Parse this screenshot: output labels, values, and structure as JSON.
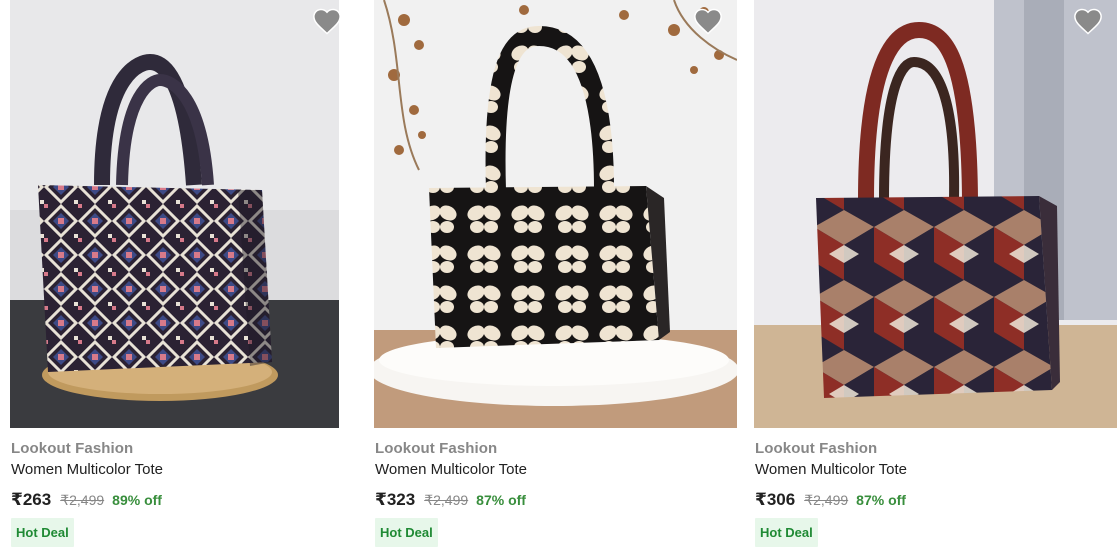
{
  "products": [
    {
      "brand": "Lookout Fashion",
      "title": "Women Multicolor Tote",
      "price": "₹263",
      "mrp": "₹2,499",
      "discount": "89% off",
      "badge": "Hot Deal",
      "image_icon": "tote-bag-aztec-pattern",
      "wishlist_icon": "heart-icon"
    },
    {
      "brand": "Lookout Fashion",
      "title": "Women Multicolor Tote",
      "price": "₹323",
      "mrp": "₹2,499",
      "discount": "87% off",
      "badge": "Hot Deal",
      "image_icon": "tote-bag-butterfly-pattern",
      "wishlist_icon": "heart-icon"
    },
    {
      "brand": "Lookout Fashion",
      "title": "Women Multicolor Tote",
      "price": "₹306",
      "mrp": "₹2,499",
      "discount": "87% off",
      "badge": "Hot Deal",
      "image_icon": "tote-bag-cube-patchwork",
      "wishlist_icon": "heart-icon"
    }
  ],
  "colors": {
    "discount": "#388e3c",
    "badge_bg": "#e7f7ea",
    "badge_text": "#1f8a34",
    "brand_text": "#878787",
    "title_text": "#212121"
  }
}
